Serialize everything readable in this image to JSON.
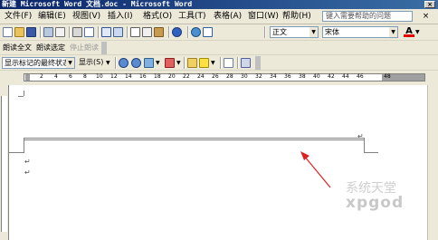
{
  "window": {
    "title": "新建 Microsoft Word 文档.doc - Microsoft Word",
    "close_glyph": "×"
  },
  "menubar": {
    "items": [
      {
        "label": "文件(F)"
      },
      {
        "label": "编辑(E)"
      },
      {
        "label": "视图(V)"
      },
      {
        "label": "插入(I)"
      },
      {
        "label": "格式(O)"
      },
      {
        "label": "工具(T)"
      },
      {
        "label": "表格(A)"
      },
      {
        "label": "窗口(W)"
      },
      {
        "label": "帮助(H)"
      }
    ],
    "help_placeholder": "键入需要帮助的问题",
    "close_glyph": "×"
  },
  "toolbar1": {
    "style_value": "正文",
    "font_value": "宋体",
    "font_color_letter": "A"
  },
  "toolbar2": {
    "read_all": "朗读全文",
    "read_selection": "朗读选定",
    "stop_reading": "停止朗读"
  },
  "toolbar3": {
    "markup_mode": "显示标记的最终状态",
    "show_label": "显示(S)"
  },
  "ruler": {
    "numbers": [
      "2",
      "4",
      "6",
      "8",
      "10",
      "12",
      "14",
      "16",
      "18",
      "20",
      "22",
      "24",
      "26",
      "28",
      "30",
      "32",
      "34",
      "36",
      "38",
      "40",
      "42",
      "44",
      "46",
      "48"
    ]
  },
  "document": {
    "paragraph_mark": "↵"
  },
  "watermark": {
    "chinese": "系统天堂",
    "latin": "xpgod"
  },
  "colors": {
    "titlebar": "#0a246a",
    "toolbar_bg": "#ece9d8",
    "arrow": "#e02020"
  }
}
